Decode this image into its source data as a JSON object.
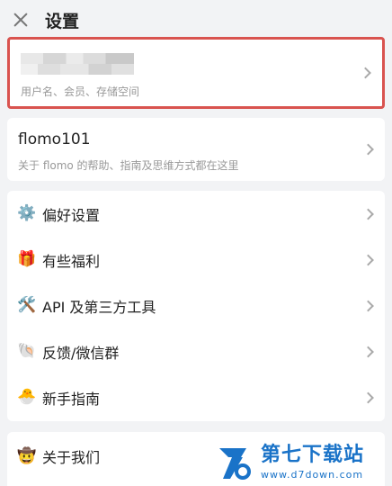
{
  "header": {
    "title": "设置",
    "close_icon": "close-icon"
  },
  "account": {
    "subtitle": "用户名、会员、存储空间"
  },
  "flomo": {
    "title": "flomo101",
    "subtitle": "关于 flomo 的帮助、指南及思维方式都在这里"
  },
  "menu": {
    "items": [
      {
        "label": "偏好设置",
        "icon": "gear-icon",
        "glyph": "⚙️"
      },
      {
        "label": "有些福利",
        "icon": "gift-icon",
        "glyph": "🎁"
      },
      {
        "label": "API 及第三方工具",
        "icon": "tools-icon",
        "glyph": "🛠️"
      },
      {
        "label": "反馈/微信群",
        "icon": "shell-icon",
        "glyph": "🐚"
      },
      {
        "label": "新手指南",
        "icon": "chick-icon",
        "glyph": "🐣"
      }
    ]
  },
  "about": {
    "label": "关于我们",
    "icon": "cowboy-icon",
    "glyph": "🤠"
  },
  "watermark": {
    "main": "第七下载站",
    "sub": "www.d7down.com"
  },
  "colors": {
    "background": "#f2f3f5",
    "highlight_border": "#d9534f",
    "watermark": "#1a73c8"
  }
}
